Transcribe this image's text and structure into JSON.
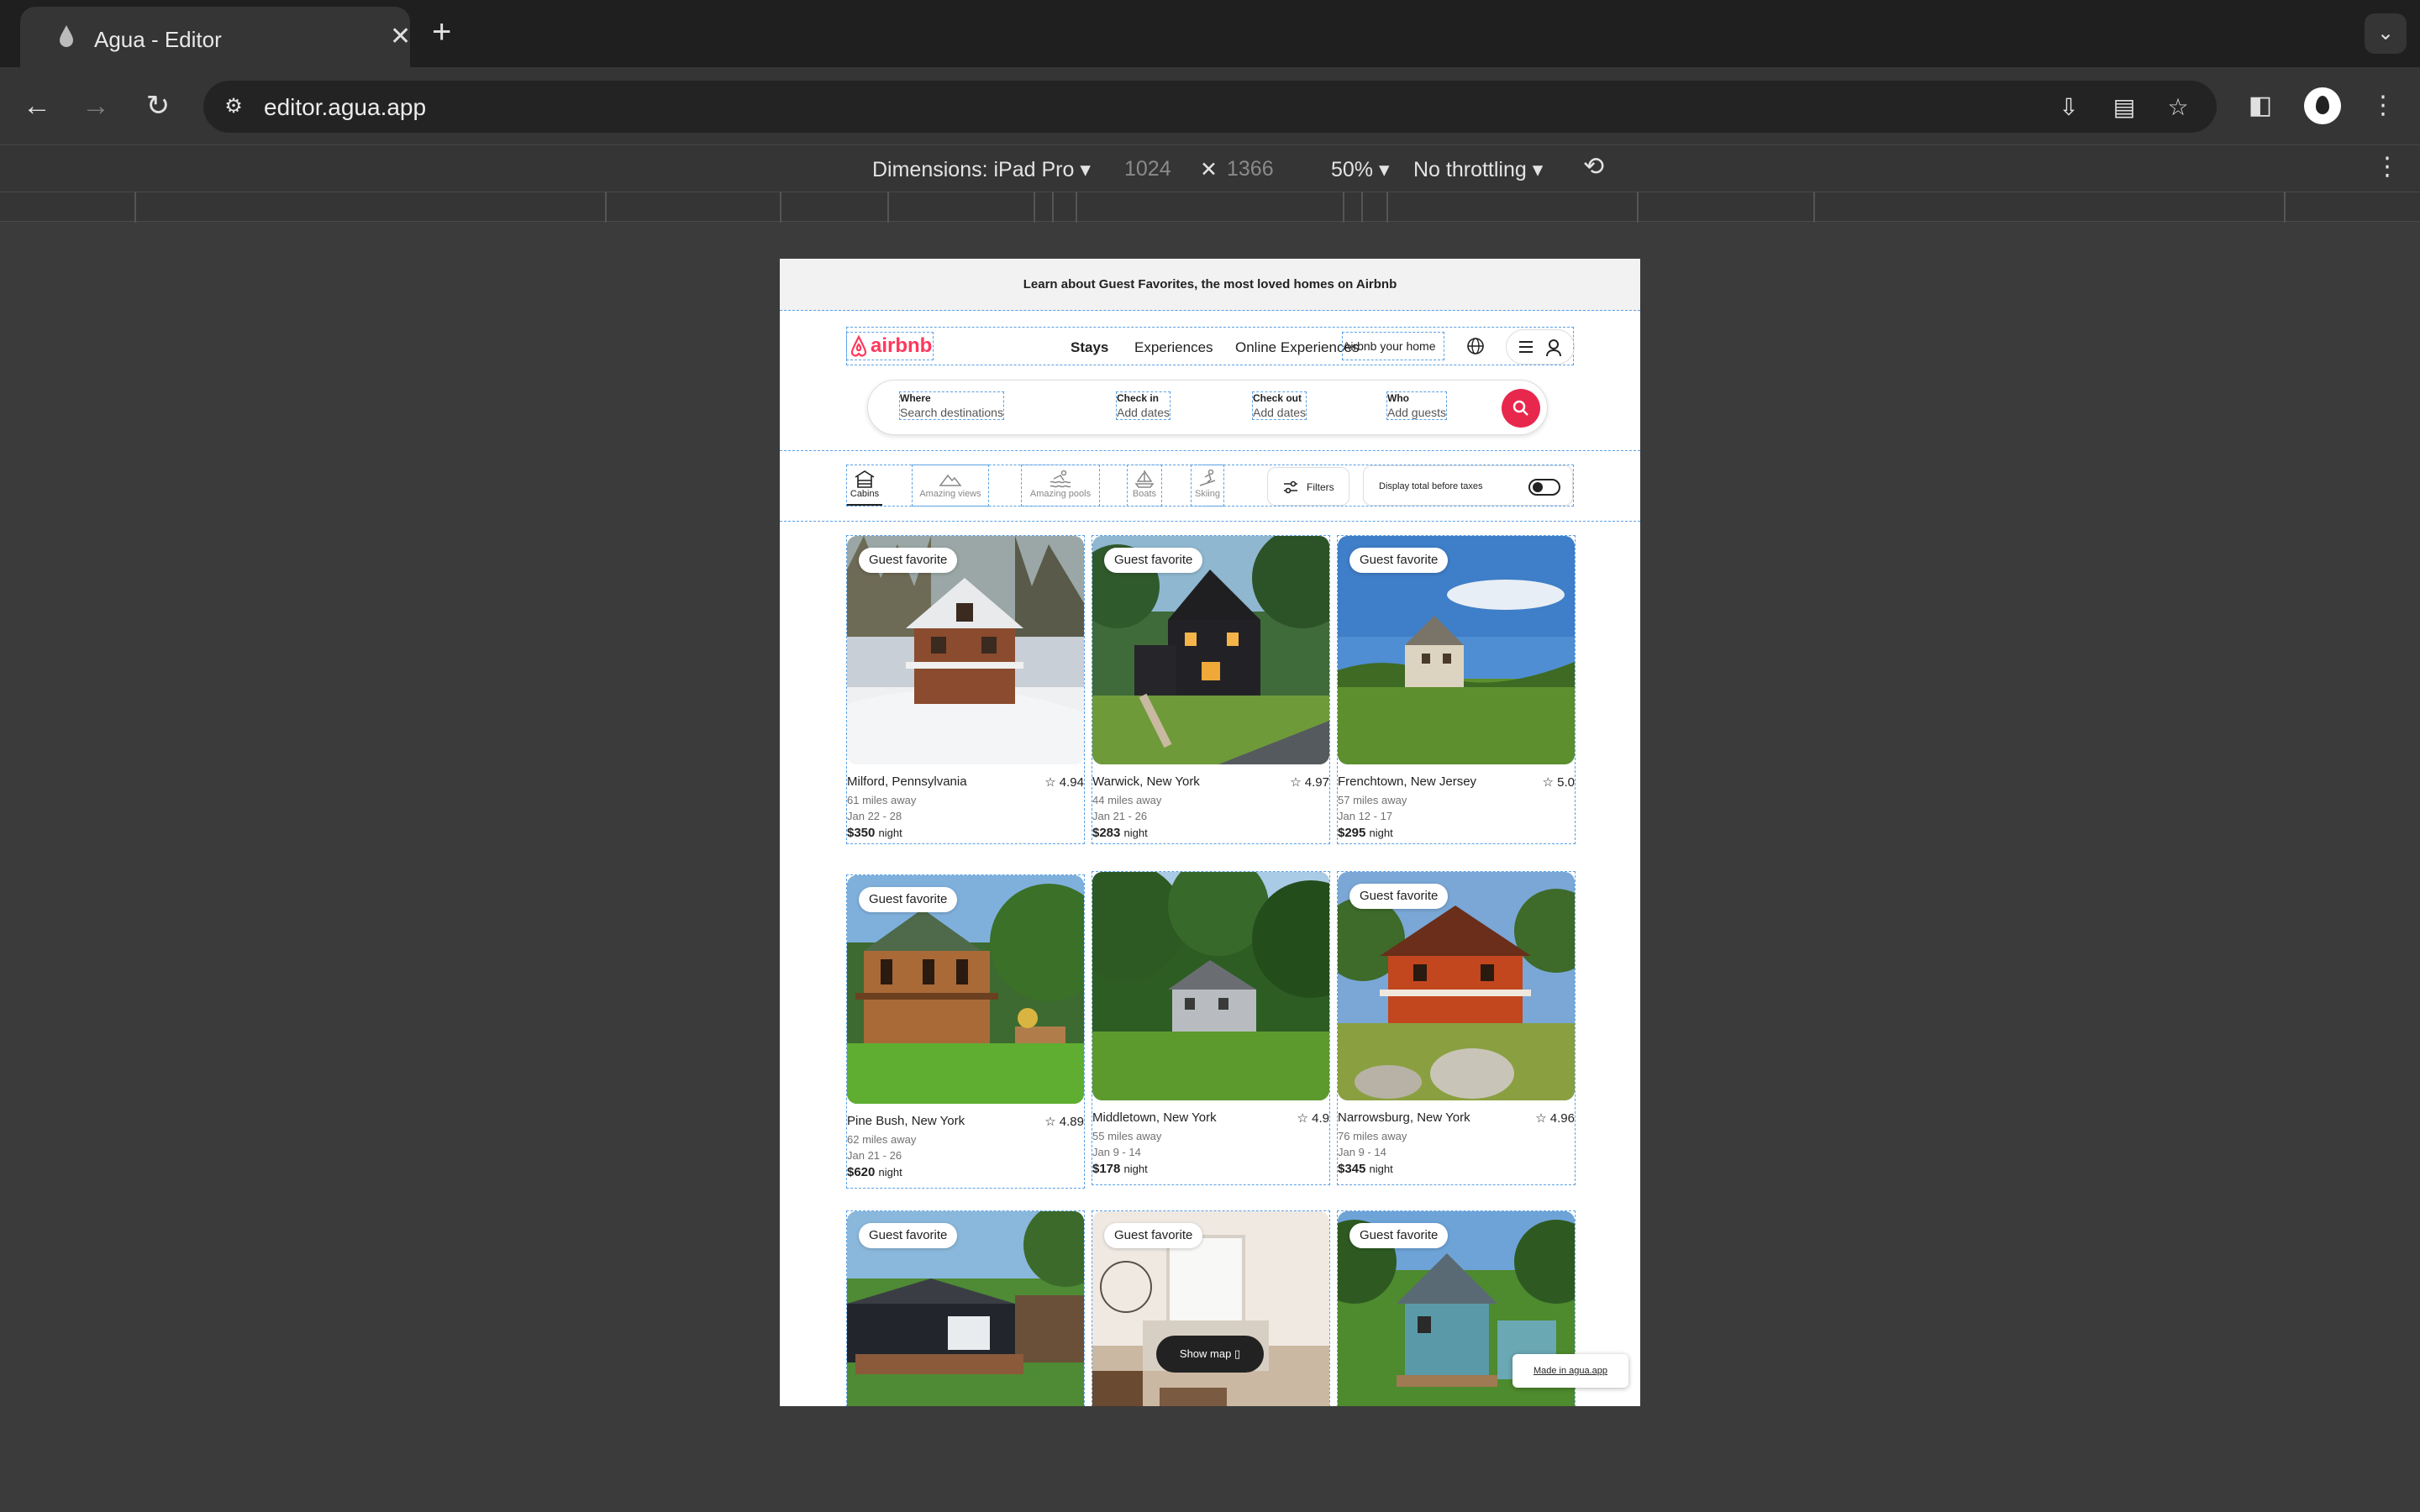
{
  "browser": {
    "tab_title": "Agua - Editor",
    "tab_close": "✕",
    "new_tab": "+",
    "url": "editor.agua.app"
  },
  "devtools": {
    "dimensions": "Dimensions: iPad Pro ▾",
    "width": "1024",
    "times": "✕",
    "height": "1366",
    "zoom": "50% ▾",
    "throttling": "No throttling ▾"
  },
  "banner": {
    "text": "Learn about Guest Favorites, the most loved homes on Airbnb"
  },
  "header": {
    "logo_text": "airbnb",
    "nav": [
      "Stays",
      "Experiences",
      "Online Experiences"
    ],
    "host_link": "Airbnb your home"
  },
  "search": {
    "where_label": "Where",
    "where_value": "Search destinations",
    "checkin_label": "Check in",
    "checkin_value": "Add dates",
    "checkout_label": "Check out",
    "checkout_value": "Add dates",
    "who_label": "Who",
    "who_value": "Add guests"
  },
  "categories": [
    "Cabins",
    "Amazing views",
    "Amazing pools",
    "Boats",
    "Skiing"
  ],
  "filters_label": "Filters",
  "taxes_label": "Display total before taxes",
  "listings": [
    {
      "badge": "Guest favorite",
      "location": "Milford, Pennsylvania",
      "rating": "☆ 4.94",
      "distance": "61 miles away",
      "dates": "Jan 22 - 28",
      "price": "$350",
      "unit": "night"
    },
    {
      "badge": "Guest favorite",
      "location": "Warwick, New York",
      "rating": "☆ 4.97",
      "distance": "44 miles away",
      "dates": "Jan 21 - 26",
      "price": "$283",
      "unit": "night"
    },
    {
      "badge": "Guest favorite",
      "location": "Frenchtown, New Jersey",
      "rating": "☆ 5.0",
      "distance": "57 miles away",
      "dates": "Jan 12 - 17",
      "price": "$295",
      "unit": "night"
    },
    {
      "badge": "Guest favorite",
      "location": "Pine Bush, New York",
      "rating": "☆ 4.89",
      "distance": "62 miles away",
      "dates": "Jan 21 - 26",
      "price": "$620",
      "unit": "night"
    },
    {
      "badge": "",
      "location": "Middletown, New York",
      "rating": "☆ 4.9",
      "distance": "55 miles away",
      "dates": "Jan 9 - 14",
      "price": "$178",
      "unit": "night"
    },
    {
      "badge": "Guest favorite",
      "location": "Narrowsburg, New York",
      "rating": "☆ 4.96",
      "distance": "76 miles away",
      "dates": "Jan 9 - 14",
      "price": "$345",
      "unit": "night"
    },
    {
      "badge": "Guest favorite"
    },
    {
      "badge": "Guest favorite"
    },
    {
      "badge": "Guest favorite"
    }
  ],
  "show_map": "Show map ▯",
  "made_in": "Made in agua.app"
}
